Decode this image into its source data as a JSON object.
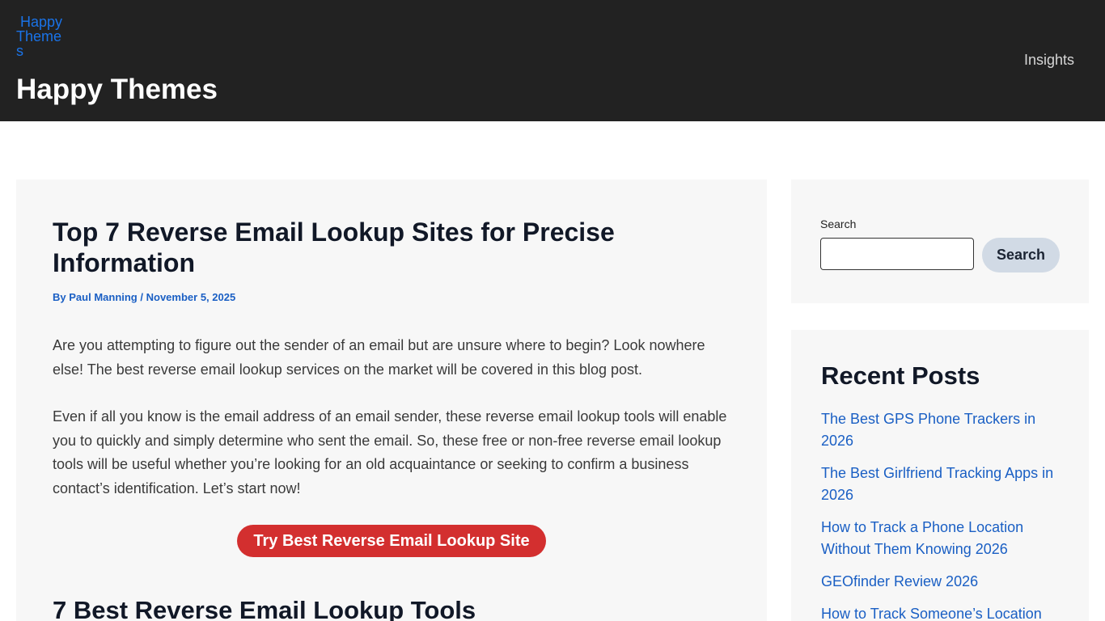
{
  "header": {
    "logo_alt": "Happy Themes",
    "site_title": "Happy Themes",
    "nav": [
      {
        "label": "Insights"
      }
    ],
    "background_color": "#222222"
  },
  "article": {
    "title": "Top 7 Reverse Email Lookup Sites for Precise Information",
    "meta": {
      "prefix": "By",
      "author": "Paul Manning",
      "separator": "/",
      "date": "November 5, 2025"
    },
    "paragraphs": [
      "Are you attempting to figure out the sender of an email but are unsure where to begin? Look nowhere else! The best reverse email lookup services on the market will be covered in this blog post.",
      "Even if all you know is the email address of an email sender, these reverse email lookup tools will enable you to quickly and simply determine who sent the email. So, these free or non-free reverse email lookup tools will be useful whether you’re looking for an old acquaintance or seeking to confirm a business contact’s identification. Let’s start now!"
    ],
    "cta_label": "Try Best Reverse Email Lookup Site",
    "cta_color": "#d32f2f",
    "section_heading": "7 Best Reverse Email Lookup Tools"
  },
  "sidebar": {
    "search": {
      "label": "Search",
      "value": "",
      "button_label": "Search"
    },
    "recent_posts": {
      "title": "Recent Posts",
      "items": [
        "The Best GPS Phone Trackers in 2026",
        "The Best Girlfriend Tracking Apps in 2026",
        "How to Track a Phone Location Without Them Knowing 2026",
        "GEOfinder Review 2026",
        "How to Track Someone’s Location"
      ]
    }
  },
  "colors": {
    "link": "#1a5fc4",
    "card_background": "#f7f7f7"
  }
}
